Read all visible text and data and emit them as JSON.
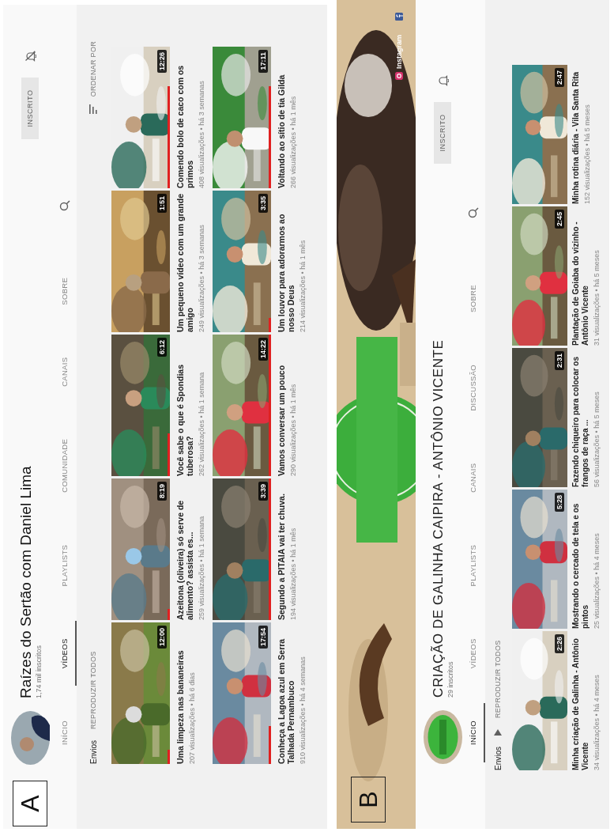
{
  "panels": [
    {
      "label": "A",
      "channel": {
        "name": "Raízes do Sertão com Daniel Lima",
        "subscribers": "1,74 mil inscritos"
      },
      "subscribe_button": "INSCRITO",
      "notifications_on": false,
      "tabs": [
        {
          "label": "INÍCIO",
          "selected": false
        },
        {
          "label": "VÍDEOS",
          "selected": true
        },
        {
          "label": "PLAYLISTS",
          "selected": false
        },
        {
          "label": "COMUNIDADE",
          "selected": false
        },
        {
          "label": "CANAIS",
          "selected": false
        },
        {
          "label": "SOBRE",
          "selected": false
        }
      ],
      "section": {
        "title": "Envios",
        "play_all": "REPRODUZIR TODOS",
        "sort": "ORDENAR POR"
      },
      "videos": [
        {
          "title": "Uma limpeza nas bananeiras",
          "meta": "207 visualizações • há 6 dias",
          "duration": "12:00",
          "level": 0.1
        },
        {
          "title": "Azeitona (oliveira) só serve de alimento? assista es...",
          "meta": "259 visualizações • há 1 semana",
          "duration": "8:19",
          "level": 0.08
        },
        {
          "title": "Você sabe o que é Spondias tuberosa?",
          "meta": "262 visualizações • há 1 semana",
          "duration": "6:12",
          "level": 0.3
        },
        {
          "title": "Um pequeno vídeo com um grande amigo",
          "meta": "249 visualizações • há 3 semanas",
          "duration": "1:51"
        },
        {
          "title": "Comendo bolo de caco com os primos",
          "meta": "408 visualizações • há 3 semanas",
          "duration": "12:26",
          "level": 0.72
        },
        {
          "title": "Conheça a Lagoa azul em Serra Talhada Pernambuco",
          "meta": "910 visualizações • há 4 semanas",
          "duration": "17:54",
          "level": 0.27
        },
        {
          "title": "Segundo a PITAIA vai ter chuva.",
          "meta": "194 visualizações • há 1 mês",
          "duration": "3:39",
          "level": 1
        },
        {
          "title": "Vamos conversar um pouco",
          "meta": "290 visualizações • há 1 mês",
          "duration": "14:22",
          "level": 1
        },
        {
          "title": "Um louvor para adorarmos ao nosso Deus",
          "meta": "214 visualizações • há 1 mês",
          "duration": "3:35",
          "level": 0.1
        },
        {
          "title": "Voltando ao sítio de tia Gilda",
          "meta": "266 visualizações • há 1 mês",
          "duration": "17:11",
          "level": 0.72
        }
      ]
    },
    {
      "label": "B",
      "banner": {
        "kind": "picture",
        "links": [
          {
            "kind": "instagram",
            "label": "Instagram"
          },
          {
            "kind": "facebook"
          }
        ]
      },
      "channel": {
        "name": "CRIAÇÃO DE GALINHA CAIPIRA - ANTÔNIO VICENTE",
        "subscribers": "29 inscritos"
      },
      "subscribe_button": "INSCRITO",
      "notifications_on": true,
      "tabs": [
        {
          "label": "INÍCIO",
          "selected": true
        },
        {
          "label": "VÍDEOS",
          "selected": false
        },
        {
          "label": "PLAYLISTS",
          "selected": false
        },
        {
          "label": "CANAIS",
          "selected": false
        },
        {
          "label": "DISCUSSÃO",
          "selected": false
        },
        {
          "label": "SOBRE",
          "selected": false
        }
      ],
      "section": {
        "title": "Envios",
        "play_all": "REPRODUZIR TODOS"
      },
      "videos": [
        {
          "title": "Minha criação de Galinha - Antônio Vicente",
          "meta": "34 visualizações • há 4 meses",
          "duration": "2:26"
        },
        {
          "title": "Mostrando o cercado de tela e os pintos",
          "meta": "25 visualizações • há 4 meses",
          "duration": "5:28"
        },
        {
          "title": "Fazendo chiqueiro para colocar os frangos de raça ...",
          "meta": "56 visualizações • há 5 meses",
          "duration": "2:31"
        },
        {
          "title": "Plantação de Goiaba do vizinho - Antônio Vicente",
          "meta": "31 visualizações • há 5 meses",
          "duration": "2:45"
        },
        {
          "title": "Minha rotina diária - Vila Santa Rita",
          "meta": "152 visualizações • há 5 meses",
          "duration": "2:47"
        }
      ]
    }
  ]
}
